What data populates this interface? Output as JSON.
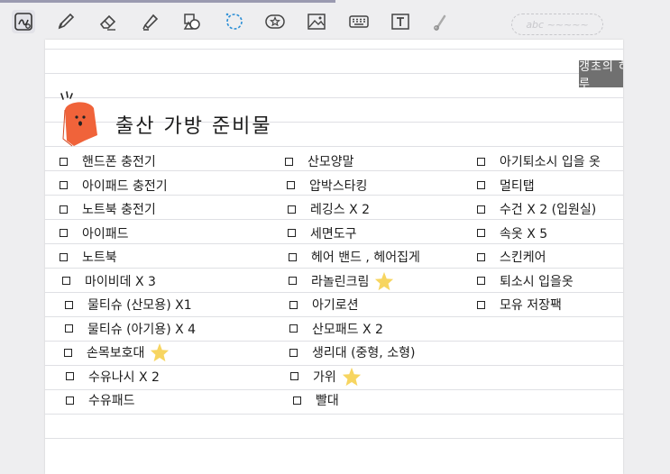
{
  "toolbar": {
    "tools": [
      "handwriting-icon",
      "pen-icon",
      "eraser-icon",
      "highlighter-icon",
      "shapes-icon",
      "lasso-icon",
      "sticker-icon",
      "image-icon",
      "keyboard-icon",
      "textbox-icon",
      "laser-pointer-icon"
    ],
    "search_placeholder": "abc ~~~~~"
  },
  "page": {
    "tag": "갱초의 하루",
    "title": "출산 가방  준비물"
  },
  "checklist": {
    "col1": [
      "핸드폰 충전기",
      "아이패드 충전기",
      "노트북 충전기",
      "아이패드",
      "노트북",
      "마이비데 X 3",
      "물티슈 (산모용) X1",
      "물티슈 (아기용) X 4",
      "손목보호대",
      "수유나시 X 2",
      "수유패드"
    ],
    "col2": [
      "산모양말",
      "압박스타킹",
      "레깅스 X 2",
      "세면도구",
      "헤어 밴드 , 헤어집게",
      "라놀린크림",
      "아기로션",
      "산모패드 X 2",
      "생리대 (중형, 소형)",
      "가위",
      "빨대"
    ],
    "col3": [
      "아기퇴소시 입을 옷",
      "멀티탭",
      "수건 X 2 (입원실)",
      "속옷 X 5",
      "스킨케어",
      "퇴소시 입을옷",
      "모유 저장팩"
    ]
  },
  "colors": {
    "mascot": "#f0633a",
    "star": "#f7d560",
    "tag_bg": "#707070"
  }
}
